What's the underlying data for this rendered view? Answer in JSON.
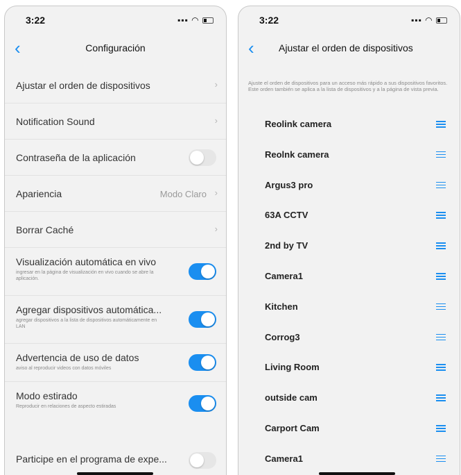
{
  "left": {
    "time": "3:22",
    "title": "Configuración",
    "rows": [
      {
        "title": "Ajustar el orden de dispositivos"
      },
      {
        "title": "Notification Sound"
      },
      {
        "title": "Contraseña de la aplicación",
        "toggle": "off"
      },
      {
        "title": "Apariencia",
        "value": "Modo Claro"
      },
      {
        "title": "Borrar Caché"
      },
      {
        "title": "Visualización automática en vivo",
        "subtitle": "ingresar en la  página de visualización en vivo cuando se abre la aplicación.",
        "toggle": "on"
      },
      {
        "title": "Agregar dispositivos automática...",
        "subtitle": "agregar dispositivos a la lista de dispositivos automáticamente en LAN",
        "toggle": "on"
      },
      {
        "title": "Advertencia de uso de datos",
        "subtitle": "aviso al reproducir videos con datos móviles",
        "toggle": "on"
      },
      {
        "title": "Modo estirado",
        "subtitle": "Reproducir en relaciones de aspecto estiradas",
        "toggle": "on"
      },
      {
        "title": "Participe en el programa de expe...",
        "toggle": "off"
      }
    ]
  },
  "right": {
    "time": "3:22",
    "title": "Ajustar el orden de dispositivos",
    "description": "Ajuste el orden de dispositivos para un acceso más rápido a sus dispositivos favoritos. Este orden también se aplica a la lista de dispositivos y a la página de vista previa.",
    "devices": [
      "Reolink camera",
      "Reolnk camera",
      "Argus3 pro",
      "63A CCTV",
      "2nd by TV",
      "Camera1",
      "Kitchen",
      "Corrog3",
      "Living Room",
      "outside cam",
      "Carport Cam",
      "Camera1"
    ]
  },
  "colors": {
    "accent": "#1a8ef0",
    "toggle_off": "#e6e6e6",
    "background": "#f2f2f2"
  },
  "icons": {
    "back": "chevron-left-icon",
    "row_arrow": "chevron-right-icon",
    "drag": "drag-handle-icon"
  }
}
